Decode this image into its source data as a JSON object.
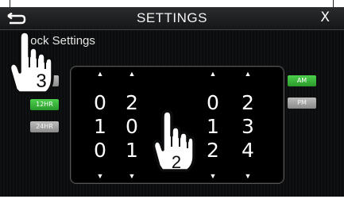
{
  "header": {
    "title": "SETTINGS",
    "close_label": "X"
  },
  "section": {
    "title": "Clock Settings"
  },
  "format_buttons": [
    {
      "label": "12HR",
      "selected": true
    },
    {
      "label": "24HR",
      "selected": false
    }
  ],
  "ampm_buttons": [
    {
      "label": "AM",
      "selected": true
    },
    {
      "label": "PM",
      "selected": false
    }
  ],
  "picker": {
    "columns": [
      {
        "digits": [
          "0",
          "1",
          "0"
        ]
      },
      {
        "digits": [
          "2",
          "0",
          "1"
        ]
      },
      {
        "digits": [
          "0",
          "1",
          "2"
        ]
      },
      {
        "digits": [
          "2",
          "3",
          "4"
        ]
      }
    ]
  },
  "callouts": {
    "step_2": "2",
    "step_3": "3"
  },
  "colors": {
    "selected_button": "#3cb83c",
    "unselected_button": "#a8a8a8",
    "background": "#0b0c0d"
  },
  "icons": {
    "back": "back-arrow-icon",
    "hand": "pointing-hand-icon"
  }
}
